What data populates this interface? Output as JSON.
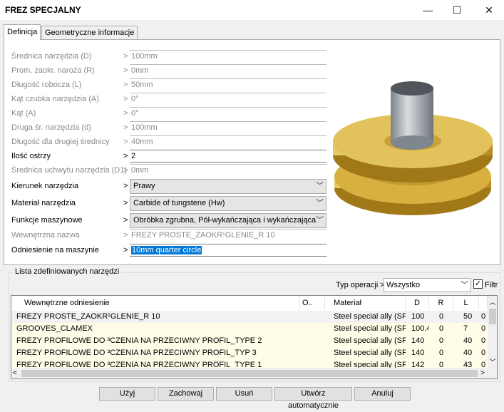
{
  "window": {
    "title": "FREZ SPECJALNY",
    "minimize": "—",
    "maximize": "☐",
    "close": "✕"
  },
  "tabs": [
    {
      "label": "Definicja",
      "active": true
    },
    {
      "label": "Geometryczne informacje",
      "active": false
    }
  ],
  "params": [
    {
      "label": "Średnica narzędzia (D)",
      "value": "100mm",
      "enabled": false
    },
    {
      "label": "Prom. zaokr. naroża (R)",
      "value": "0mm",
      "enabled": false
    },
    {
      "label": "Długość robocza (L)",
      "value": "50mm",
      "enabled": false
    },
    {
      "label": "Kąt czubka narzędzia (A)",
      "value": "0°",
      "enabled": false
    },
    {
      "label": "Kąt (A)",
      "value": "0°",
      "enabled": false
    },
    {
      "label": "Druga śr. narzędzia (d)",
      "value": "100mm",
      "enabled": false
    },
    {
      "label": "Długość dla drugiej średnicy",
      "value": "40mm",
      "enabled": false
    },
    {
      "label": "Ilość ostrzy",
      "value": "2",
      "enabled": true
    },
    {
      "label": "Średnica uchwytu narzędzia (D1)",
      "value": "0mm",
      "enabled": false
    }
  ],
  "combos": [
    {
      "label": "Kierunek narzędzia",
      "value": "Prawy"
    },
    {
      "label": "Materiał narzędzia",
      "value": "Carbide of tungstene (Hw)"
    },
    {
      "label": "Funkcje maszynowe",
      "value": "Obróbka zgrubna, Pół-wykańczająca i wykańczająca"
    }
  ],
  "internal_name": {
    "label": "Wewnętrzna nazwa",
    "value": "FREZY PROSTE_ZAOKR¹GLENIE_R 10"
  },
  "machine_ref": {
    "label": "Odniesienie na maszynie",
    "value": "10mm quarter circle"
  },
  "list": {
    "group_label": "Lista zdefiniowanych narzędzi",
    "filter_label": "Typ operacji",
    "filter_value": "Wszystko",
    "filter_checkbox_label": "Filtr",
    "filter_checked": true,
    "columns": [
      "Wewnętrzne odniesienie",
      "O..",
      "Materiał",
      "D",
      "R",
      "L",
      ""
    ],
    "rows": [
      [
        "FREZY PROSTE_ZAOKR¹GLENIE_R 10",
        "",
        "Steel special ally (SP)",
        "100",
        "0",
        "50",
        "0"
      ],
      [
        "GROOVES_CLAMEX",
        "",
        "Steel special ally (SP)",
        "100.4",
        "0",
        "7",
        "0"
      ],
      [
        "FREZY PROFILOWE DO ³CZENIA NA PRZECIWNY PROFIL_TYPE 2",
        "",
        "Steel special ally (SP)",
        "140",
        "0",
        "40",
        "0"
      ],
      [
        "FREZY PROFILOWE DO ³CZENIA NA PRZECIWNY PROFIL_TYP 3",
        "",
        "Steel special ally (SP)",
        "140",
        "0",
        "40",
        "0"
      ],
      [
        "FREZY PROFILOWE DO ³CZENIA NA PRZECIWNY PROFIL_TYPE 1",
        "",
        "Steel special ally (SP)",
        "142",
        "0",
        "43",
        "0"
      ]
    ]
  },
  "buttons": [
    "Użyj",
    "Zachowaj",
    "Usuń",
    "Utwórz automatycznie",
    "Anuluj"
  ],
  "colors": {
    "selection": "#0078d7",
    "row_highlight": "#fffde8",
    "tool_gold": "#d8b040",
    "shank_gray": "#9aa0a8"
  }
}
